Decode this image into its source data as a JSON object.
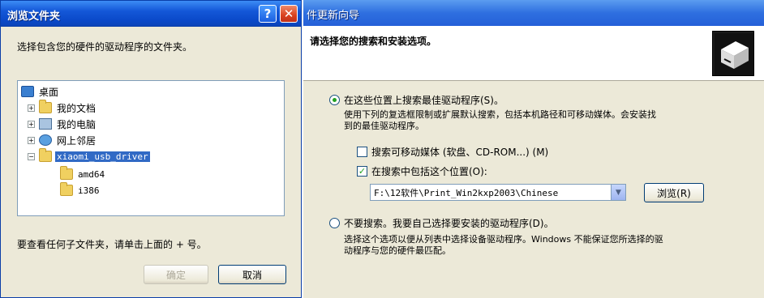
{
  "browse_dialog": {
    "title": "浏览文件夹",
    "help_glyph": "?",
    "close_glyph": "✕",
    "instruction": "选择包含您的硬件的驱动程序的文件夹。",
    "tree": [
      {
        "label": "桌面",
        "icon": "desktop-icon",
        "expander": ""
      },
      {
        "label": "我的文档",
        "icon": "folder-icon",
        "expander": "+"
      },
      {
        "label": "我的电脑",
        "icon": "computer-icon",
        "expander": "+"
      },
      {
        "label": "网上邻居",
        "icon": "network-icon",
        "expander": "+"
      },
      {
        "label": "xiaomi_usb_driver",
        "icon": "folder-icon",
        "expander": "−",
        "selected": true
      },
      {
        "label": "amd64",
        "icon": "folder-icon",
        "expander": ""
      },
      {
        "label": "i386",
        "icon": "folder-icon",
        "expander": ""
      }
    ],
    "hint": "要查看任何子文件夹，请单击上面的 + 号。",
    "ok_label": "确定",
    "cancel_label": "取消"
  },
  "wizard": {
    "title": "件更新向导",
    "header_title": "请选择您的搜索和安装选项。",
    "option1_label": "在这些位置上搜索最佳驱动程序(S)。",
    "option1_desc_line1": "使用下列的复选框限制或扩展默认搜索，包括本机路径和可移动媒体。会安装找",
    "option1_desc_line2": "到的最佳驱动程序。",
    "check1_label": "搜索可移动媒体 (软盘、CD-ROM...) (M)",
    "check1_checked": false,
    "check2_label": "在搜索中包括这个位置(O):",
    "check2_checked": true,
    "path_value": "F:\\12软件\\Print_Win2kxp2003\\Chinese",
    "browse_label": "浏览(R)",
    "option2_label": "不要搜索。我要自己选择要安装的驱动程序(D)。",
    "option2_desc_line1": "选择这个选项以便从列表中选择设备驱动程序。Windows 不能保证您所选择的驱",
    "option2_desc_line2": "动程序与您的硬件最匹配。",
    "selected_option": "option1"
  },
  "colors": {
    "titlebar_blue": "#0a48c8",
    "selection_blue": "#316ac5",
    "dialog_bg": "#ece9d8"
  }
}
